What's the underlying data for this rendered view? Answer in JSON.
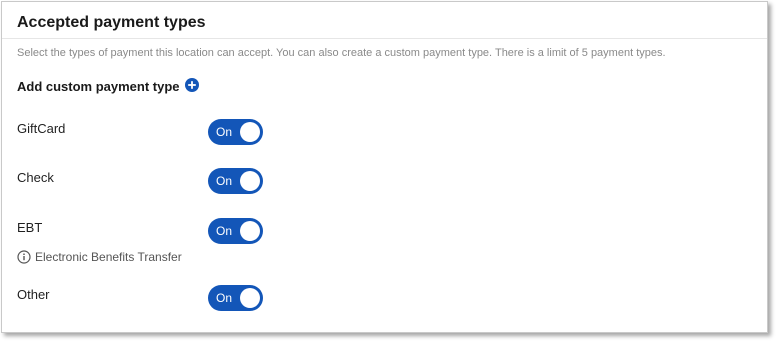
{
  "section": {
    "title": "Accepted payment types",
    "description": "Select the types of payment this location can accept. You can also create a custom payment type. There is a limit of 5 payment types."
  },
  "add_custom": {
    "label": "Add custom payment type",
    "icon": "plus-circle-icon"
  },
  "payment_types": [
    {
      "label": "GiftCard",
      "toggle": "On",
      "enabled": true
    },
    {
      "label": "Check",
      "toggle": "On",
      "enabled": true
    },
    {
      "label": "EBT",
      "toggle": "On",
      "enabled": true,
      "info": "Electronic Benefits Transfer"
    },
    {
      "label": "Other",
      "toggle": "On",
      "enabled": true
    }
  ],
  "colors": {
    "accent": "#1356b8",
    "description_text": "#8a8a8a",
    "border": "#c9c9c9"
  }
}
